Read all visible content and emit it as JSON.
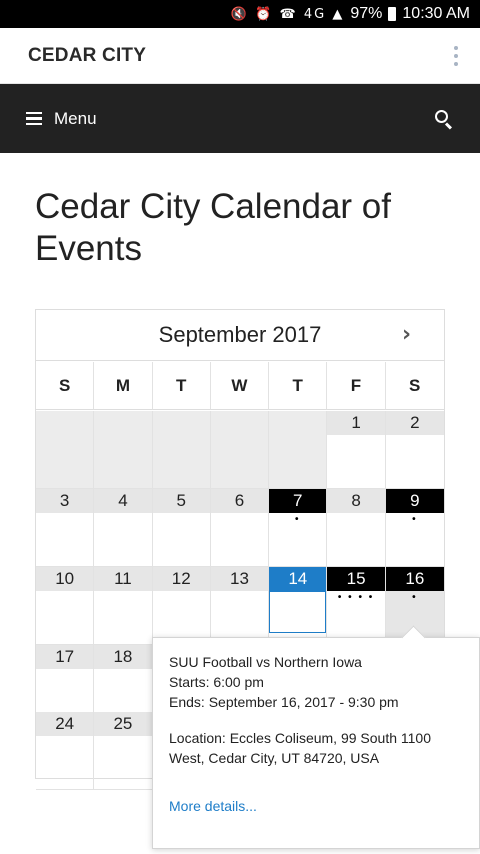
{
  "status_bar": {
    "icons": "🔇 ⏰ ☎ 4G ▲",
    "battery": "97%",
    "time": "10:30 AM"
  },
  "site": {
    "title": "CEDAR CITY"
  },
  "nav": {
    "menu_label": "Menu"
  },
  "page": {
    "title": "Cedar City Calendar of Events"
  },
  "calendar": {
    "month": "September 2017",
    "next_icon": "›",
    "weekdays": [
      "S",
      "M",
      "T",
      "W",
      "T",
      "F",
      "S"
    ],
    "weeks": [
      [
        "",
        "",
        "",
        "",
        "",
        "1",
        "2"
      ],
      [
        "3",
        "4",
        "5",
        "6",
        "7",
        "8",
        "9"
      ],
      [
        "10",
        "11",
        "12",
        "13",
        "14",
        "15",
        "16"
      ],
      [
        "17",
        "18",
        "",
        "",
        "",
        "",
        ""
      ],
      [
        "24",
        "25",
        "",
        "",
        "",
        "",
        ""
      ]
    ],
    "event_dots": {
      "7": "•",
      "9": "•",
      "15": "• • • •",
      "16": "•"
    }
  },
  "popup": {
    "title": "SUU Football vs Northern Iowa",
    "starts": "Starts: 6:00 pm",
    "ends": "Ends: September 16, 2017 - 9:30 pm",
    "location_1": "Location: Eccles Coliseum, 99 South 1100",
    "location_2": "West, Cedar City, UT 84720, USA",
    "more_link": "More details..."
  },
  "colors": {
    "accent": "#1e7dc8",
    "nav_bg": "#222222",
    "highlight_day": "#000000"
  }
}
